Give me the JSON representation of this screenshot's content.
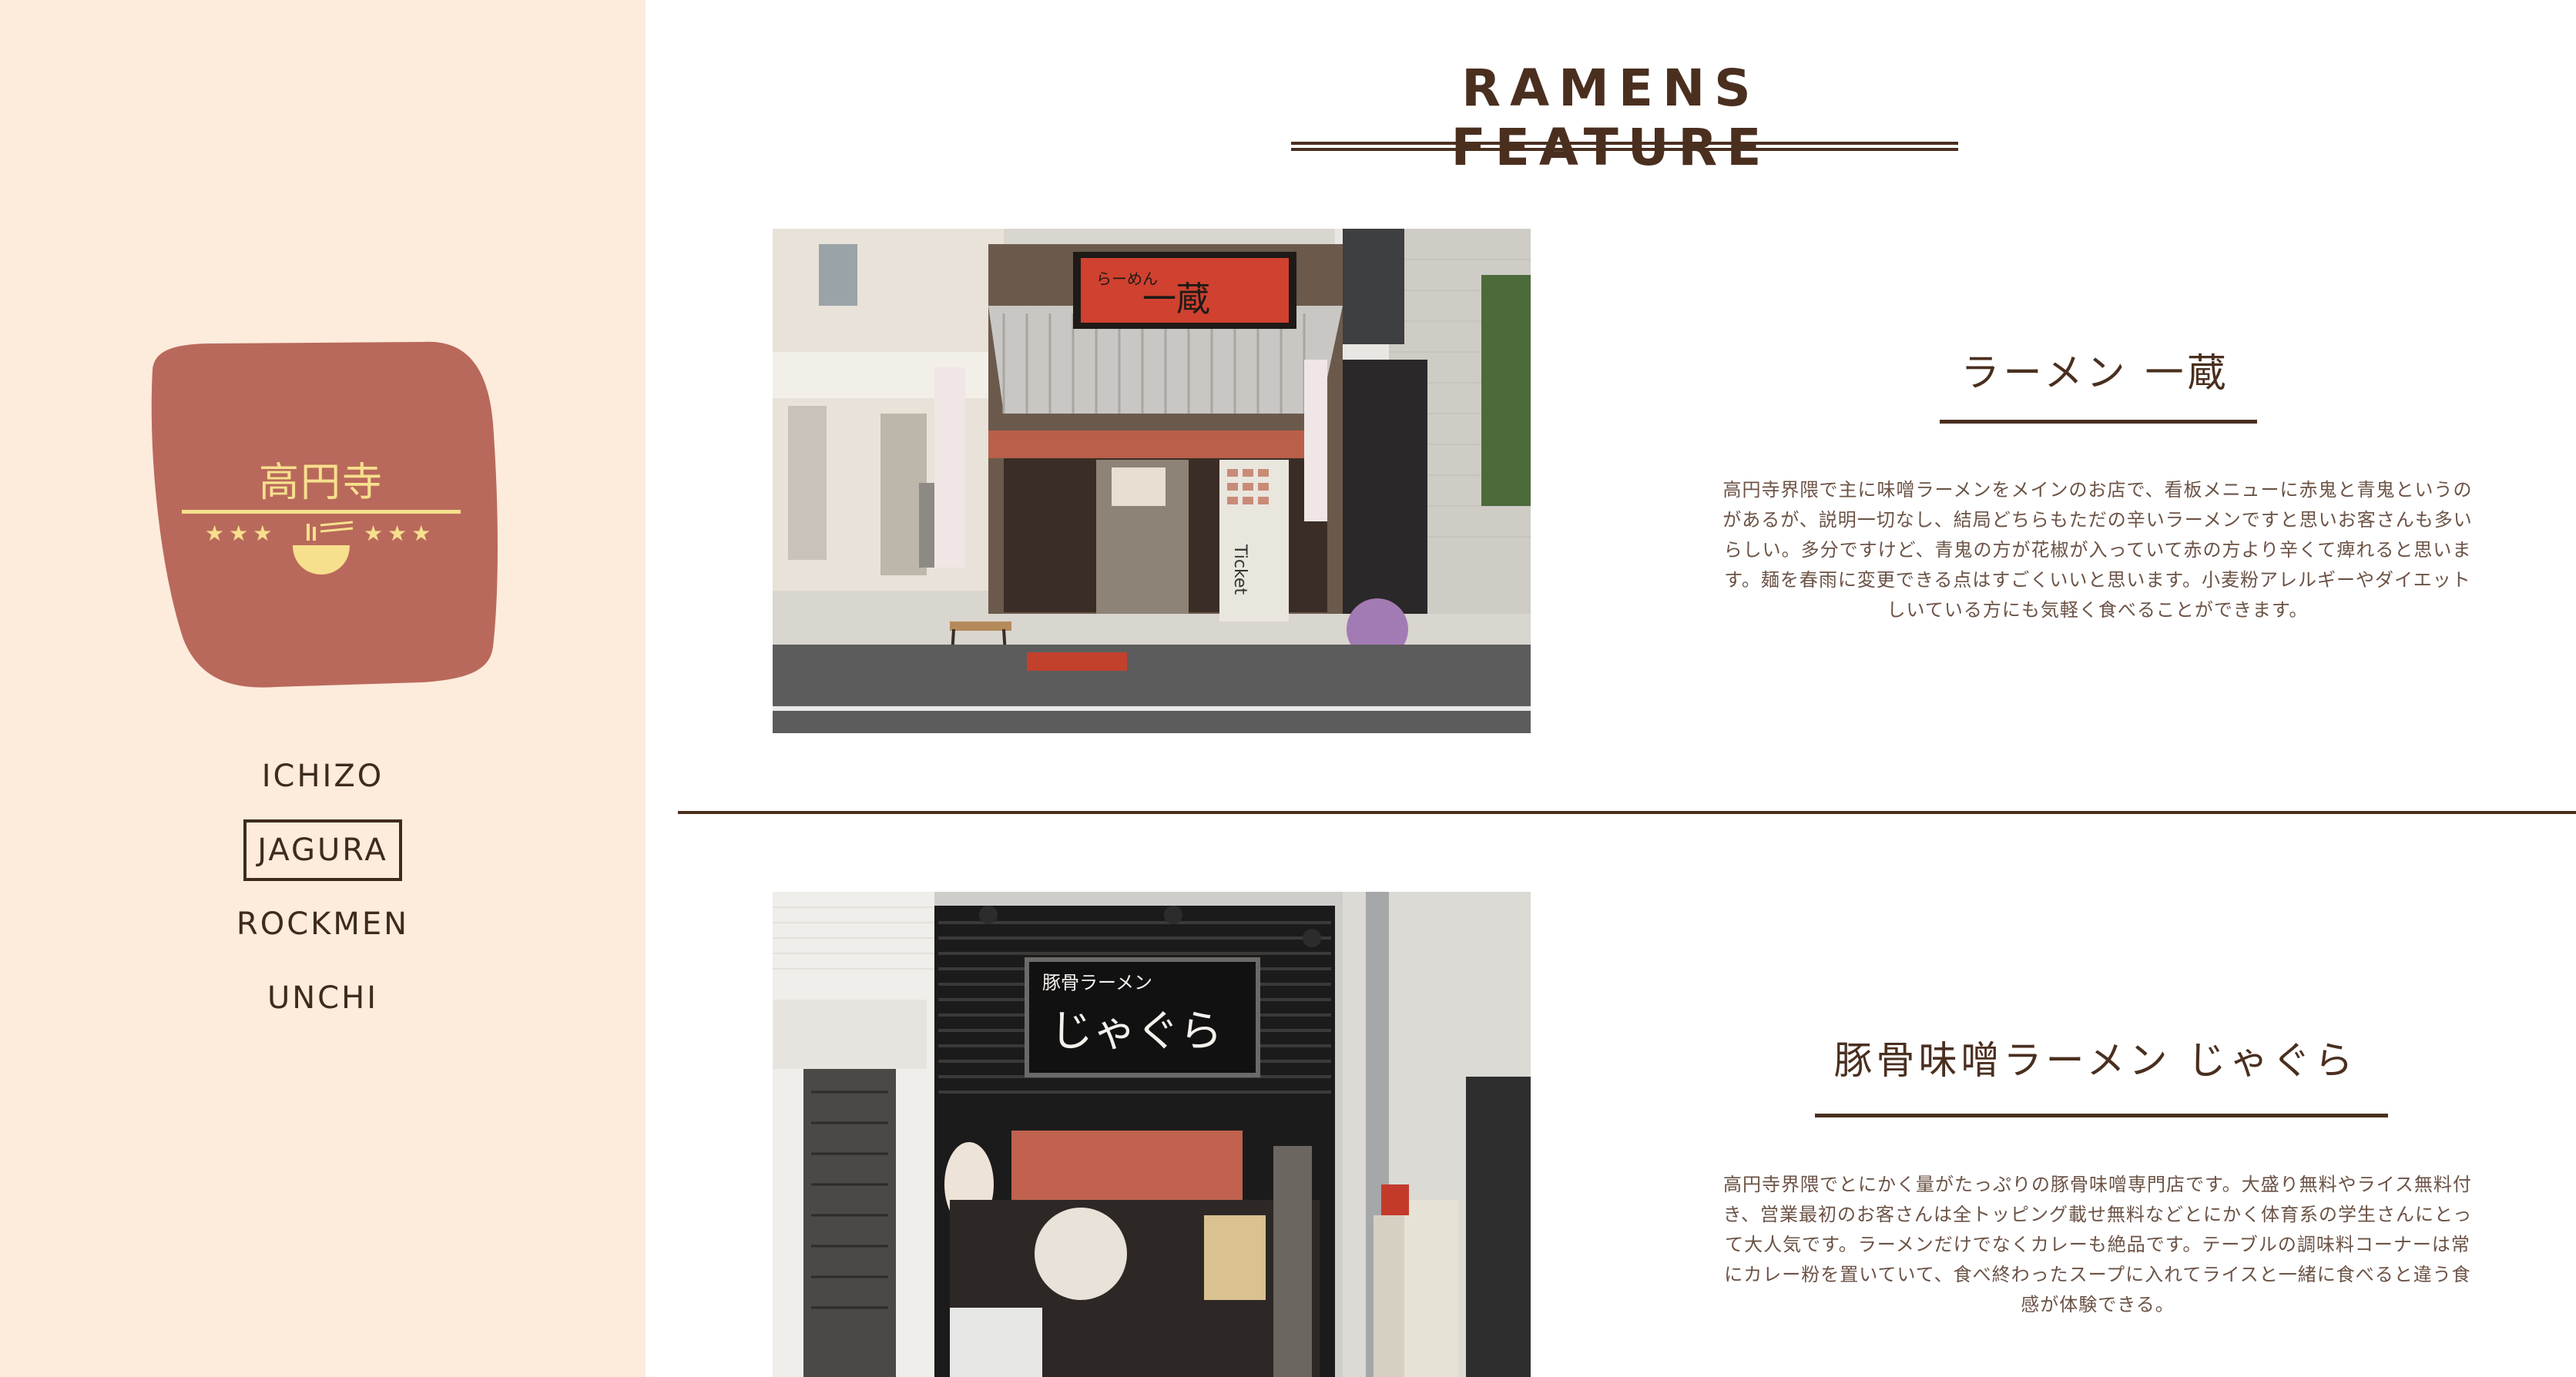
{
  "logo": {
    "title": "高円寺",
    "stars_left": "★★★",
    "stars_right": "★★★",
    "colors": {
      "badge": "#b9695b",
      "accent": "#f7e08d"
    }
  },
  "nav": {
    "items": [
      {
        "label": "ICHIZO",
        "active": false
      },
      {
        "label": "JAGURA",
        "active": true
      },
      {
        "label": "ROCKMEN",
        "active": false
      },
      {
        "label": "UNCHI",
        "active": false
      }
    ]
  },
  "page": {
    "title": "RAMENS FEATURE"
  },
  "shops": [
    {
      "name": "ラーメン 一蔵",
      "sign": "一蔵",
      "sign_small": "らーめん",
      "ticket": "Ticket",
      "description": "高円寺界隈で主に味噌ラーメンをメインのお店で、看板メニューに赤鬼と青鬼というのがあるが、説明一切なし、結局どちらもただの辛いラーメンですと思いお客さんも多いらしい。多分ですけど、青鬼の方が花椒が入っていて赤の方より辛くて痺れると思います。麺を春雨に変更できる点はすごくいいと思います。小麦粉アレルギーやダイエットしいている方にも気軽く食べることができます。"
    },
    {
      "name": "豚骨味噌ラーメン じゃぐら",
      "sign_top": "豚骨ラーメン",
      "sign": "じゃぐら",
      "description": "高円寺界隈でとにかく量がたっぷりの豚骨味噌専門店です。大盛り無料やライス無料付き、営業最初のお客さんは全トッピング載せ無料などとにかく体育系の学生さんにとって大人気です。ラーメンだけでなくカレーも絶品です。テーブルの調味料コーナーは常にカレー粉を置いていて、食べ終わったスープに入れてライスと一緒に食べると違う食感が体験できる。"
    }
  ],
  "colors": {
    "sidebar_bg": "#fdebdc",
    "text_dark": "#4a2f1f",
    "text_body": "#6b5346"
  }
}
